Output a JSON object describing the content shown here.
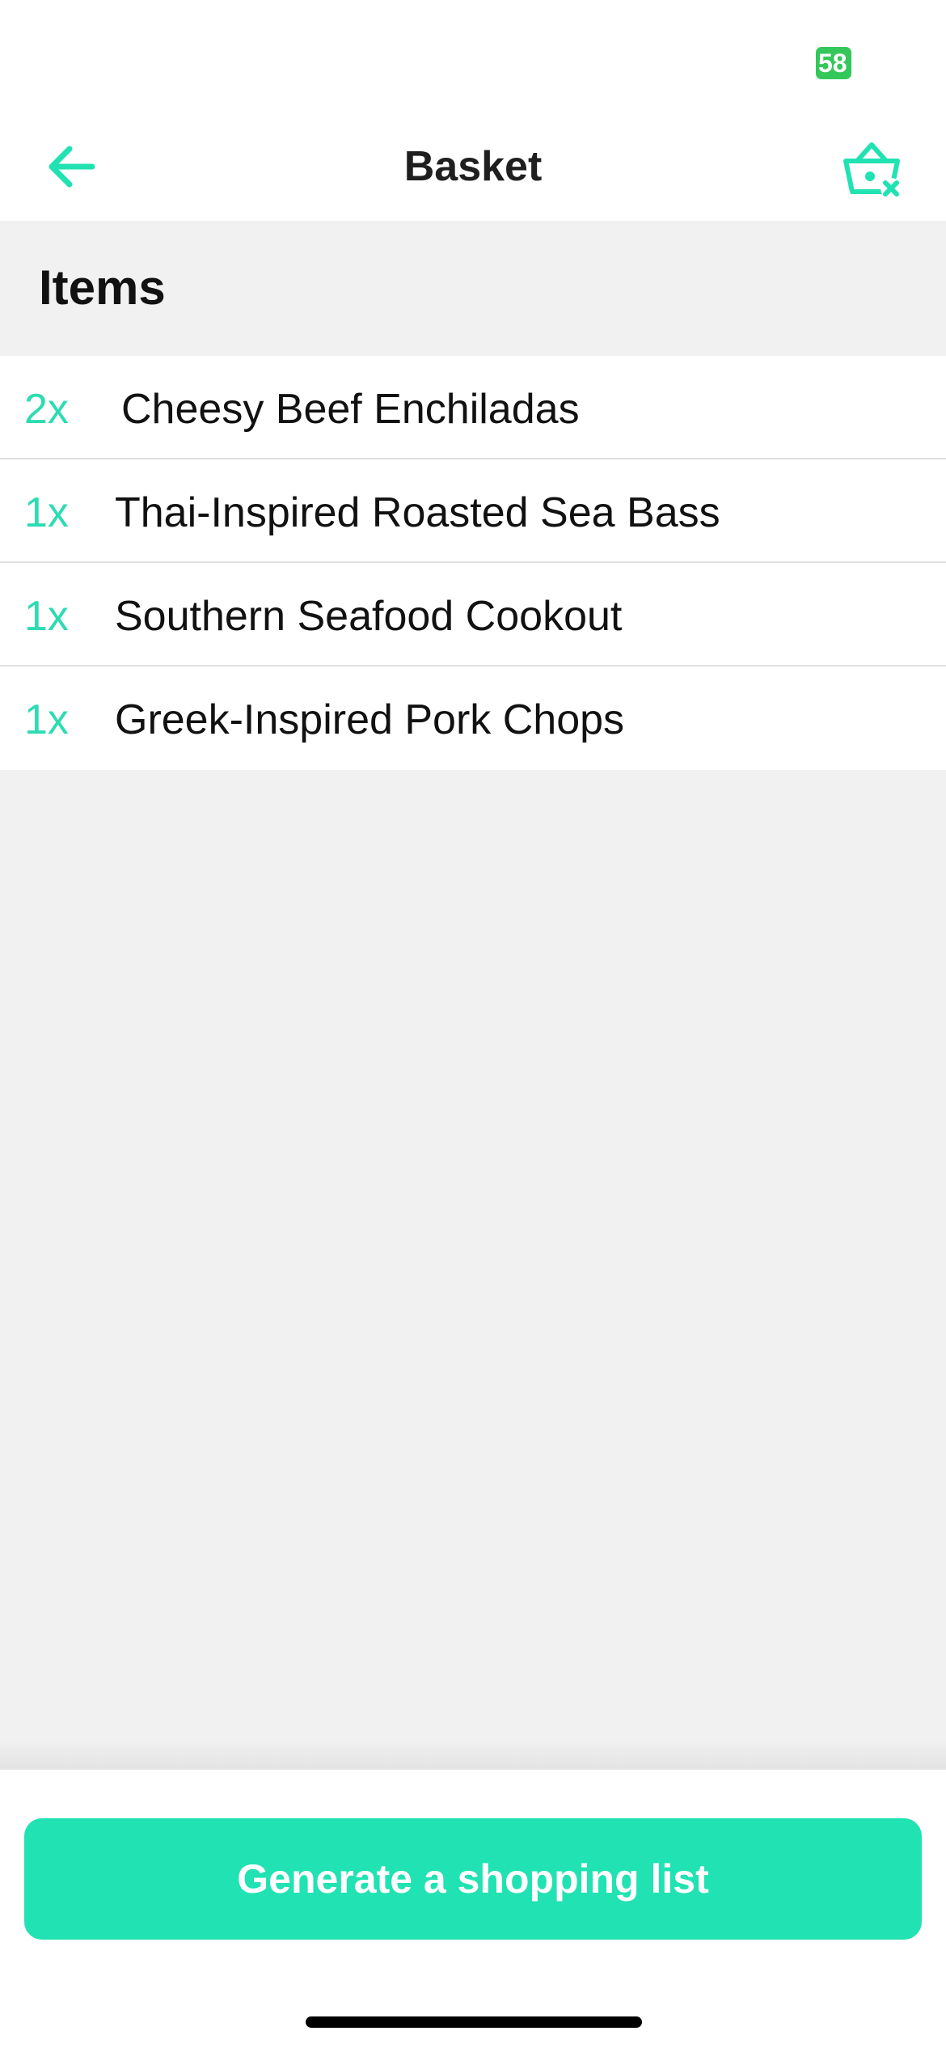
{
  "status_bar": {
    "battery": "58"
  },
  "nav": {
    "title": "Basket",
    "back_icon": "arrow-left-icon",
    "clear_icon": "basket-clear-icon",
    "accent_color": "#21e2b2"
  },
  "section": {
    "title": "Items"
  },
  "items": [
    {
      "qty": "2x",
      "name": "Cheesy Beef Enchiladas"
    },
    {
      "qty": "1x",
      "name": "Thai-Inspired Roasted Sea Bass"
    },
    {
      "qty": "1x",
      "name": "Southern Seafood Cookout"
    },
    {
      "qty": "1x",
      "name": "Greek-Inspired Pork Chops"
    }
  ],
  "footer": {
    "button_label": "Generate a shopping list"
  },
  "colors": {
    "accent": "#21e2b2",
    "qty_text": "#2cdcb1",
    "background": "#f1f1f1",
    "battery": "#34c759"
  }
}
